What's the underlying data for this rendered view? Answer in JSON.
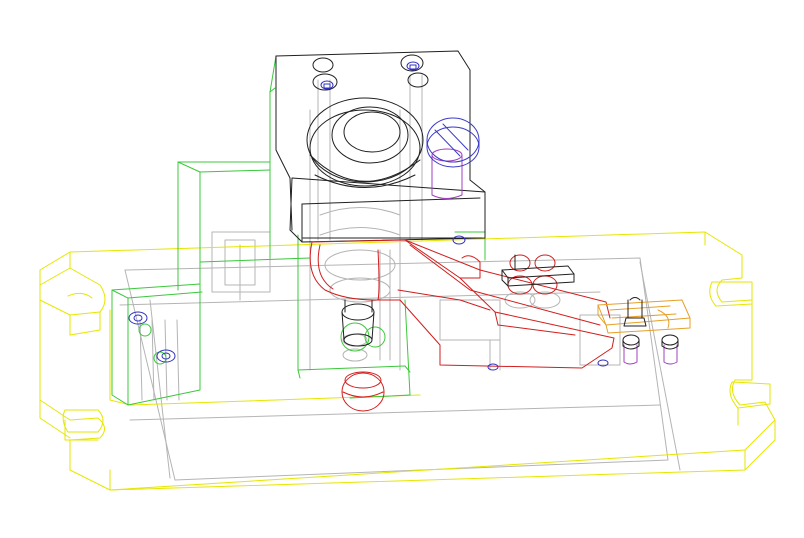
{
  "colors": {
    "background": "#ffffff",
    "base_plate": "#e6e600",
    "guide_block": "#3cc83c",
    "die_head": "#202020",
    "hidden_lines": "#b4b4b4",
    "arm_part": "#d21e1e",
    "adjust_bracket": "#e6a028",
    "fastener": "#3030c0",
    "pin": "#a040c0",
    "screw_head": "#3c3cc8"
  },
  "icons": {
    "socket_screw": "hex-socket-screw-icon",
    "slotted_screw": "slotted-screw-icon"
  }
}
